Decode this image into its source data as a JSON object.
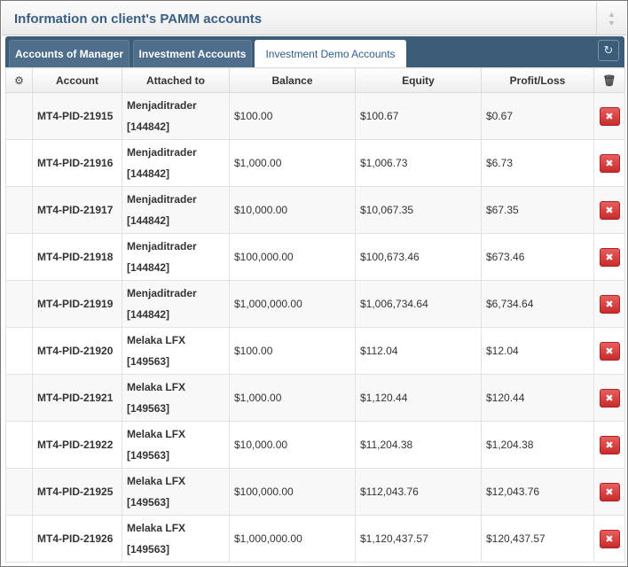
{
  "widget": {
    "title": "Information on client's PAMM accounts",
    "sort_icon": "sort-updown-icon",
    "refresh_icon": "refresh-icon"
  },
  "tabs": [
    {
      "label": "Accounts of Manager",
      "active": false
    },
    {
      "label": "Investment Accounts",
      "active": false
    },
    {
      "label": "Investment Demo Accounts",
      "active": true
    }
  ],
  "table": {
    "settings_icon": "gear-icon",
    "delete_header_icon": "trash-icon",
    "columns": {
      "account": "Account",
      "attached": "Attached to",
      "balance": "Balance",
      "equity": "Equity",
      "profit": "Profit/Loss"
    },
    "rows": [
      {
        "account": "MT4-PID-21915",
        "name": "Menjaditrader",
        "id": "[144842]",
        "balance": "$100.00",
        "equity": "$100.67",
        "profit": "$0.67"
      },
      {
        "account": "MT4-PID-21916",
        "name": "Menjaditrader",
        "id": "[144842]",
        "balance": "$1,000.00",
        "equity": "$1,006.73",
        "profit": "$6.73"
      },
      {
        "account": "MT4-PID-21917",
        "name": "Menjaditrader",
        "id": "[144842]",
        "balance": "$10,000.00",
        "equity": "$10,067.35",
        "profit": "$67.35"
      },
      {
        "account": "MT4-PID-21918",
        "name": "Menjaditrader",
        "id": "[144842]",
        "balance": "$100,000.00",
        "equity": "$100,673.46",
        "profit": "$673.46"
      },
      {
        "account": "MT4-PID-21919",
        "name": "Menjaditrader",
        "id": "[144842]",
        "balance": "$1,000,000.00",
        "equity": "$1,006,734.64",
        "profit": "$6,734.64"
      },
      {
        "account": "MT4-PID-21920",
        "name": "Melaka LFX",
        "id": "[149563]",
        "balance": "$100.00",
        "equity": "$112.04",
        "profit": "$12.04"
      },
      {
        "account": "MT4-PID-21921",
        "name": "Melaka LFX",
        "id": "[149563]",
        "balance": "$1,000.00",
        "equity": "$1,120.44",
        "profit": "$120.44"
      },
      {
        "account": "MT4-PID-21922",
        "name": "Melaka LFX",
        "id": "[149563]",
        "balance": "$10,000.00",
        "equity": "$11,204.38",
        "profit": "$1,204.38"
      },
      {
        "account": "MT4-PID-21925",
        "name": "Melaka LFX",
        "id": "[149563]",
        "balance": "$100,000.00",
        "equity": "$112,043.76",
        "profit": "$12,043.76"
      },
      {
        "account": "MT4-PID-21926",
        "name": "Melaka LFX",
        "id": "[149563]",
        "balance": "$1,000,000.00",
        "equity": "$1,120,437.57",
        "profit": "$120,437.57"
      }
    ]
  }
}
